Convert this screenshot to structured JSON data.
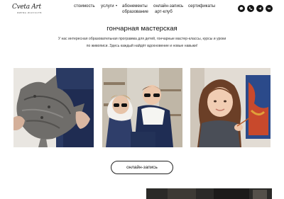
{
  "header": {
    "logo": {
      "script": "Cveta Art",
      "tagline": "ФИРМА ИСКУССТВ"
    },
    "nav": [
      {
        "label": "стоимость"
      },
      {
        "label": "услуги",
        "has_dropdown": true
      },
      {
        "label": "абонементы"
      },
      {
        "label": "онлайн-запись"
      },
      {
        "label": "сертификаты"
      },
      {
        "label": "образование"
      },
      {
        "label": "арт-клуб"
      }
    ],
    "social": [
      {
        "icon": "vk-messenger-icon"
      },
      {
        "icon": "phone-icon"
      },
      {
        "icon": "telegram-icon"
      },
      {
        "icon": "vk-icon"
      }
    ]
  },
  "main": {
    "title": "гончарная мастерская",
    "description": "У нас интересная образовательная программа для детей, гончарные мастер-классы, курсы и уроки по живописи. Здесь каждый найдёт вдохновение и новые навыки!",
    "photos": [
      {
        "name": "ceramic-fish-photo"
      },
      {
        "name": "kids-in-sunglasses-photo"
      },
      {
        "name": "girl-painting-photo"
      }
    ],
    "cta_label": "онлайн-запись"
  }
}
